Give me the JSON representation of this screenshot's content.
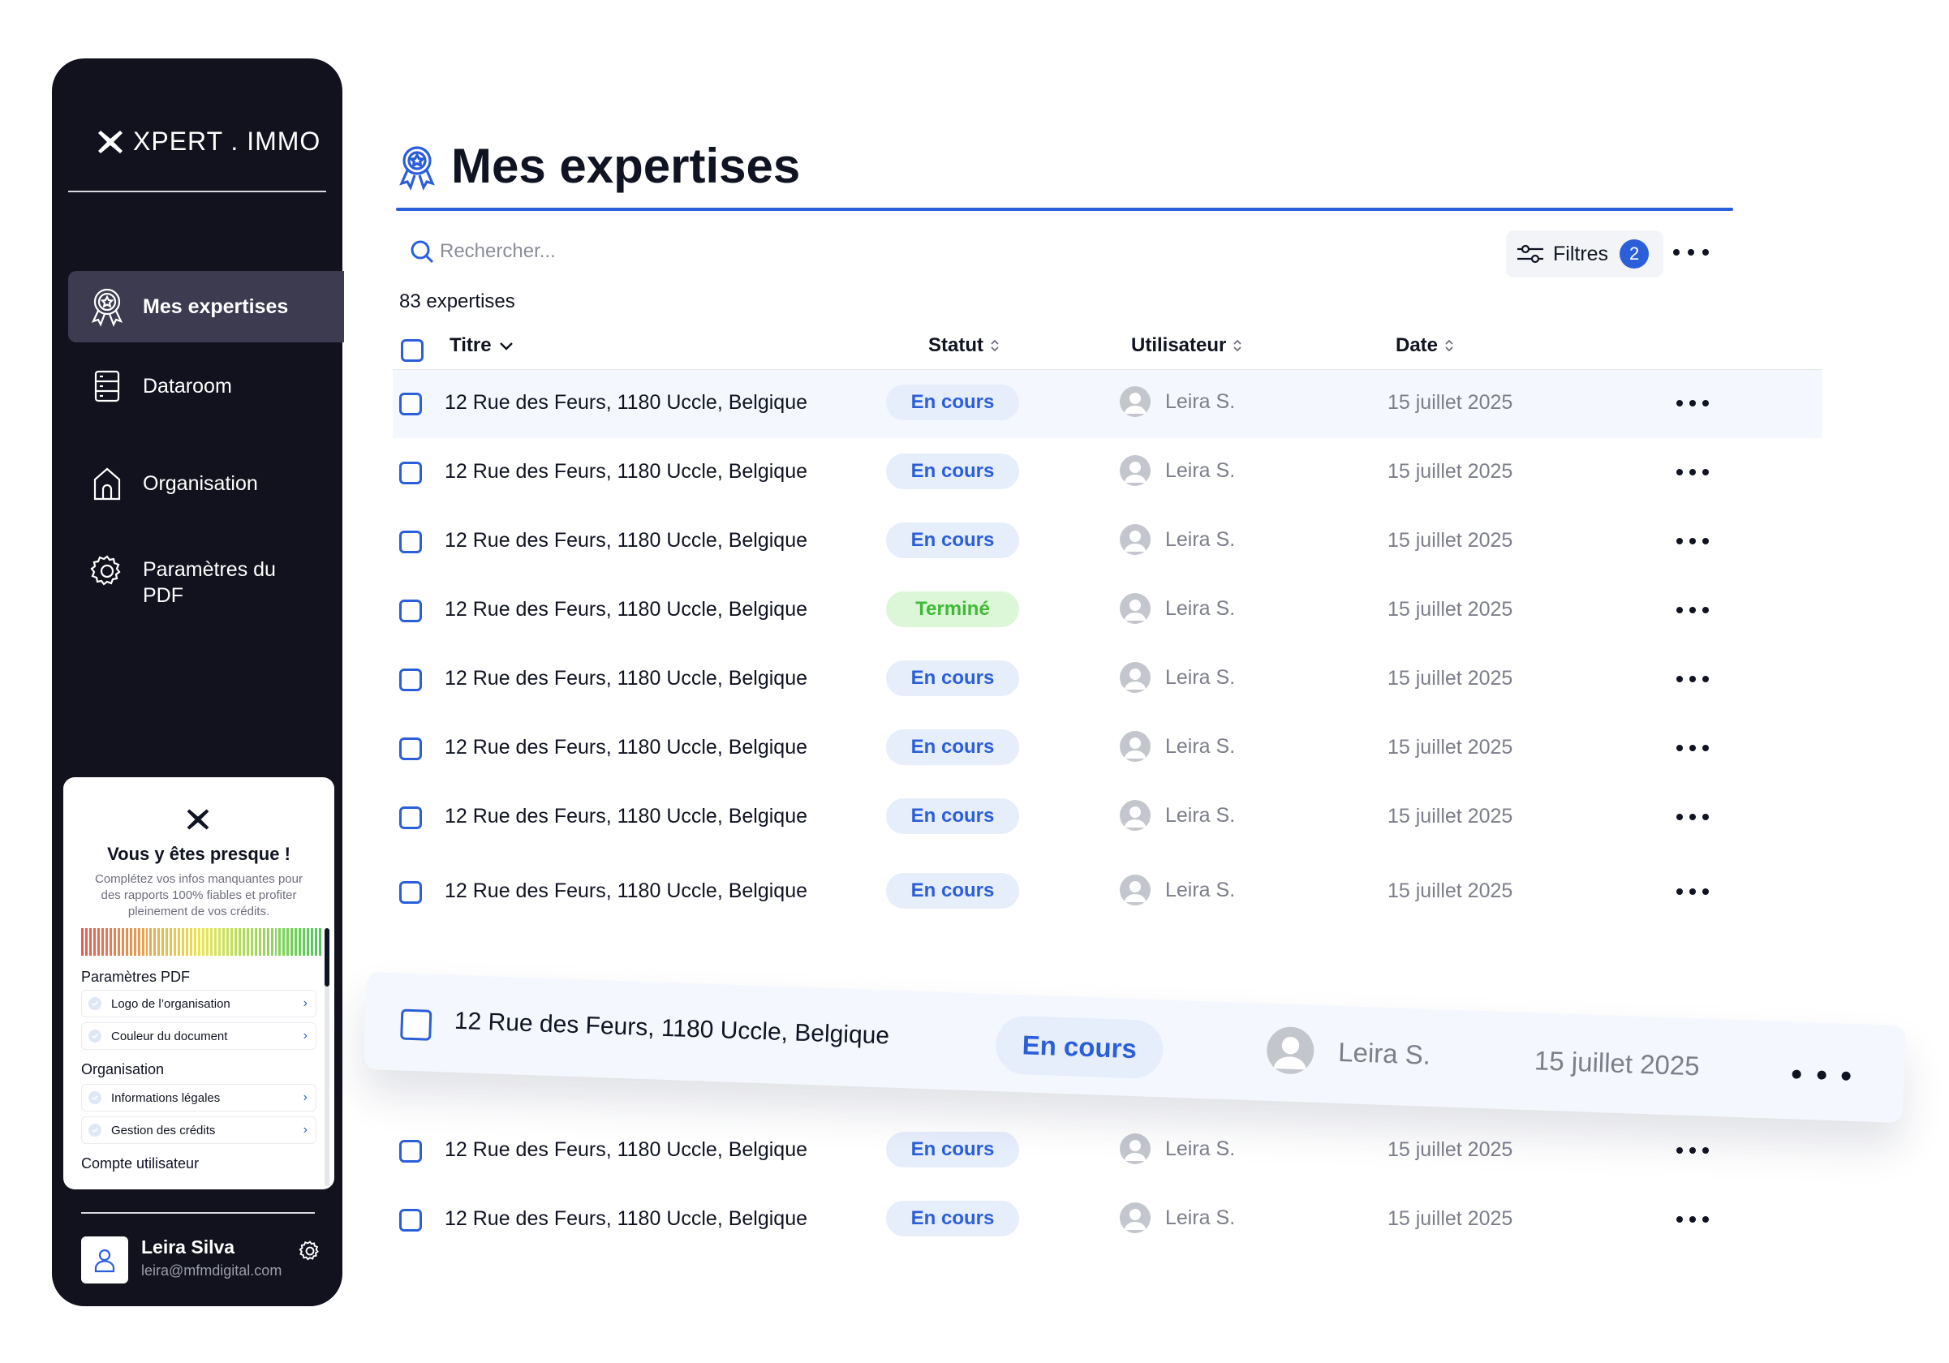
{
  "sidebar": {
    "brand": "XPERT . IMMO",
    "nav": [
      {
        "label": "Mes expertises",
        "icon": "award-badge-icon",
        "active": true
      },
      {
        "label": "Dataroom",
        "icon": "database-icon",
        "active": false
      },
      {
        "label": "Organisation",
        "icon": "building-icon",
        "active": false
      },
      {
        "label": "Paramètres du PDF",
        "icon": "settings-gear-icon",
        "active": false
      }
    ],
    "promo": {
      "title": "Vous y êtes presque !",
      "description": "Complétez vos infos manquantes pour des rapports 100% fiables et profiter pleinement de vos crédits.",
      "sections": [
        {
          "title": "Paramètres PDF",
          "items": [
            "Logo de l’organisation",
            "Couleur du document"
          ]
        },
        {
          "title": "Organisation",
          "items": [
            "Informations légales",
            "Gestion des crédits"
          ]
        },
        {
          "title": "Compte utilisateur",
          "items": []
        }
      ]
    },
    "user": {
      "name": "Leira Silva",
      "email": "leira@mfmdigital.com"
    }
  },
  "main": {
    "title": "Mes expertises",
    "search_placeholder": "Rechercher...",
    "filters_label": "Filtres",
    "filters_count": "2",
    "count_label": "83 expertises",
    "columns": {
      "title": "Titre",
      "status": "Statut",
      "user": "Utilisateur",
      "date": "Date"
    },
    "rows": [
      {
        "title": "12 Rue des Feurs, 1180 Uccle, Belgique",
        "status": "En cours",
        "user": "Leira S.",
        "date": "15 juillet 2025"
      },
      {
        "title": "12 Rue des Feurs, 1180 Uccle, Belgique",
        "status": "En cours",
        "user": "Leira S.",
        "date": "15 juillet 2025"
      },
      {
        "title": "12 Rue des Feurs, 1180 Uccle, Belgique",
        "status": "En cours",
        "user": "Leira S.",
        "date": "15 juillet 2025"
      },
      {
        "title": "12 Rue des Feurs, 1180 Uccle, Belgique",
        "status": "Terminé",
        "user": "Leira S.",
        "date": "15 juillet 2025"
      },
      {
        "title": "12 Rue des Feurs, 1180 Uccle, Belgique",
        "status": "En cours",
        "user": "Leira S.",
        "date": "15 juillet 2025"
      },
      {
        "title": "12 Rue des Feurs, 1180 Uccle, Belgique",
        "status": "En cours",
        "user": "Leira S.",
        "date": "15 juillet 2025"
      },
      {
        "title": "12 Rue des Feurs, 1180 Uccle, Belgique",
        "status": "En cours",
        "user": "Leira S.",
        "date": "15 juillet 2025"
      },
      {
        "title": "12 Rue des Feurs, 1180 Uccle, Belgique",
        "status": "En cours",
        "user": "Leira S.",
        "date": "15 juillet 2025"
      },
      {
        "title": "12 Rue des Feurs, 1180 Uccle, Belgique",
        "status": "En cours",
        "user": "Leira S.",
        "date": "15 juillet 2025"
      },
      {
        "title": "12 Rue des Feurs, 1180 Uccle, Belgique",
        "status": "En cours",
        "user": "Leira S.",
        "date": "15 juillet 2025"
      }
    ],
    "dragged_row": {
      "title": "12 Rue des Feurs, 1180 Uccle, Belgique",
      "status": "En cours",
      "user": "Leira S.",
      "date": "15 juillet 2025"
    }
  },
  "colors": {
    "accent": "#2b5fd9",
    "sidebar_bg": "#12121f",
    "active_nav_bg": "#3c3b50",
    "status_done": "#3fbb35"
  }
}
